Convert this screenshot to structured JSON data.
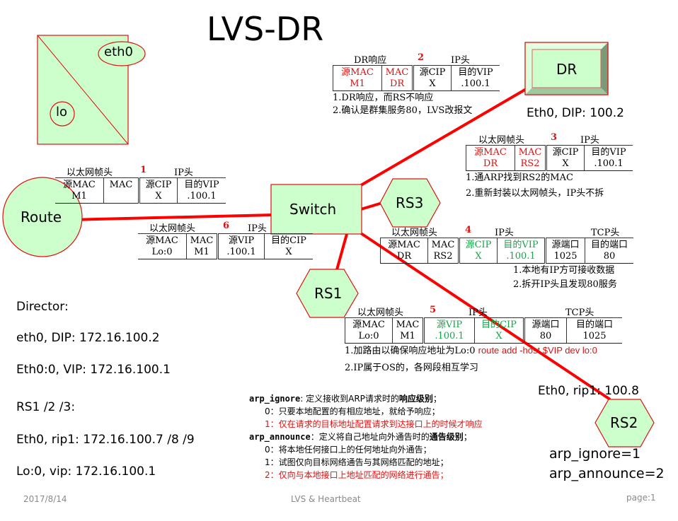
{
  "title": "LVS-DR",
  "legend_box": {
    "eth0": "eth0",
    "lo": "lo"
  },
  "nodes": {
    "route": "Route",
    "switch": "Switch",
    "dr": "DR",
    "rs1": "RS1",
    "rs2": "RS2",
    "rs3": "RS3"
  },
  "node_labels": {
    "dr_ip": "Eth0, DIP: 100.2",
    "rs2_ip": "Eth0, rip1: 100.8"
  },
  "colors": {
    "node_fill": "#ccffcc",
    "node_stroke": "#e01010",
    "link": "#ff0000",
    "highlight_red": "#e01010",
    "highlight_green": "#1aa34a"
  },
  "packets": [
    {
      "step": "1",
      "left_label": "以太网帧头",
      "right_label": "IP头",
      "cells": [
        {
          "top": "源MAC",
          "bottom": "M1",
          "color": ""
        },
        {
          "top": "MAC",
          "bottom": "",
          "color": ""
        },
        {
          "top": "源CIP",
          "bottom": "X",
          "color": ""
        },
        {
          "top": "目的VIP",
          "bottom": ".100.1",
          "color": ""
        }
      ]
    },
    {
      "step": "2",
      "left_label": "DR响应",
      "right_label": "IP头",
      "cells": [
        {
          "top": "源MAC",
          "bottom": "M1",
          "color": "red"
        },
        {
          "top": "MAC",
          "bottom": "DR",
          "color": "red"
        },
        {
          "top": "源CIP",
          "bottom": "X",
          "color": ""
        },
        {
          "top": "目的VIP",
          "bottom": ".100.1",
          "color": ""
        }
      ],
      "notes": [
        "1.DR响应，而RS不响应",
        "2.确认是群集服务80，LVS改报文"
      ]
    },
    {
      "step": "3",
      "left_label": "以太网帧头",
      "right_label": "IP头",
      "cells": [
        {
          "top": "源MAC",
          "bottom": "DR",
          "color": "red"
        },
        {
          "top": "MAC",
          "bottom": "RS2",
          "color": "red"
        },
        {
          "top": "源CIP",
          "bottom": "X",
          "color": ""
        },
        {
          "top": "目的VIP",
          "bottom": ".100.1",
          "color": ""
        }
      ],
      "notes": [
        "1.通ARP找到RS2的MAC",
        "2.重新封装以太网帧头，IP头不拆"
      ]
    },
    {
      "step": "4",
      "left_label": "以太网帧头",
      "right_label": "IP头",
      "tcp_label": "TCP头",
      "cells": [
        {
          "top": "源MAC",
          "bottom": "DR",
          "color": ""
        },
        {
          "top": "MAC",
          "bottom": "RS2",
          "color": ""
        },
        {
          "top": "源CIP",
          "bottom": "X",
          "color": "green"
        },
        {
          "top": "目的VIP",
          "bottom": ".100.1",
          "color": "green"
        },
        {
          "top": "源端口",
          "bottom": "1025",
          "color": ""
        },
        {
          "top": "目的端口",
          "bottom": "80",
          "color": ""
        }
      ],
      "notes": [
        "1.本地有IP方可接收数据",
        "2.拆开IP头且发现80服务"
      ]
    },
    {
      "step": "5",
      "left_label": "以太网帧头",
      "right_label": "IP头",
      "tcp_label": "TCP头",
      "cells": [
        {
          "top": "源MAC",
          "bottom": "Lo:0",
          "color": ""
        },
        {
          "top": "MAC",
          "bottom": "M1",
          "color": ""
        },
        {
          "top": "源VIP",
          "bottom": ".100.1",
          "color": "green"
        },
        {
          "top": "目的CIP",
          "bottom": "X",
          "color": "green"
        },
        {
          "top": "源端口",
          "bottom": "80",
          "color": ""
        },
        {
          "top": "目的端口",
          "bottom": "1025",
          "color": ""
        }
      ],
      "notes": [
        "1.加路由以确保响应地址为Lo:0",
        "2.IP属于OS的，各网段相互学习"
      ],
      "command": "route add -host $VIP dev lo:0"
    },
    {
      "step": "6",
      "left_label": "以太网帧头",
      "right_label": "IP头",
      "cells": [
        {
          "top": "源MAC",
          "bottom": "Lo:0",
          "color": ""
        },
        {
          "top": "MAC",
          "bottom": "M1",
          "color": ""
        },
        {
          "top": "源VIP",
          "bottom": ".100.1",
          "color": ""
        },
        {
          "top": "目的CIP",
          "bottom": "X",
          "color": ""
        }
      ]
    }
  ],
  "info": {
    "director_heading": "Director:",
    "director_dip": "eth0, DIP: 172.16.100.2",
    "director_vip": "Eth0:0, VIP: 172.16.100.1",
    "rs_heading": "RS1 /2 /3:",
    "rs_rip": "Eth0, rip1: 172.16.100.7 /8 /9",
    "rs_vip": "Lo:0, vip: 172.16.100.1"
  },
  "arp": {
    "ignore_kw": "arp_ignore",
    "ignore_desc": ": 定义接收到ARP请求时的",
    "ignore_bold": "响应级别",
    "ignore_end": "；",
    "ignore_0": "0：只要本地配置的有相应地址，就给予响应；",
    "ignore_1": "1：仅在请求的目标地址配置请求到达接口上的时候才响应",
    "announce_kw": "arp_announce",
    "announce_desc": "：定义将自己地址向外通告时的",
    "announce_bold": "通告级别",
    "announce_end": "；",
    "announce_0": "0：将本地任何接口上的任何地址向外通告；",
    "announce_1": "1：试图仅向目标网络通告与其网络匹配的地址；",
    "announce_2": "2：仅向与本地接口上地址匹配的网络进行通告；",
    "ignore_value": "arp_ignore=1",
    "announce_value": "arp_announce=2"
  },
  "footer": {
    "date": "2017/8/14",
    "center": "LVS & Heartbeat",
    "page": "page:1"
  }
}
